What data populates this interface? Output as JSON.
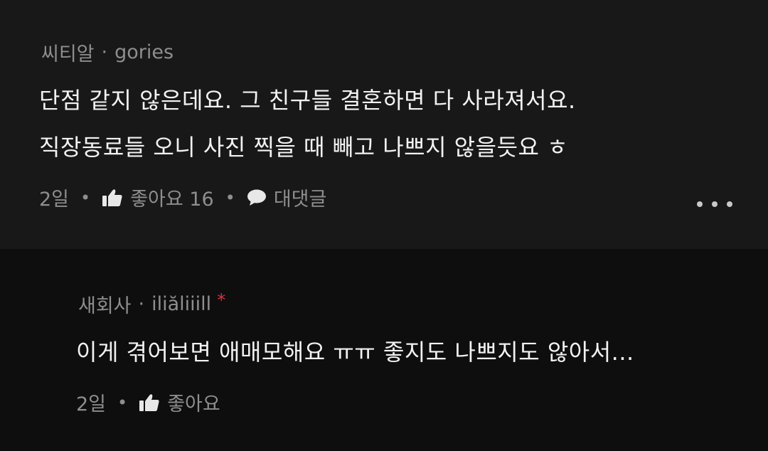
{
  "comments": [
    {
      "company": "씨티알",
      "separator": "·",
      "nickname": "gories",
      "lines": [
        "단점 같지 않은데요. 그 친구들 결혼하면 다 사라져서요.",
        "직장동료들 오니 사진 찍을 때 빼고 나쁘지 않을듯요 ㅎ"
      ],
      "time": "2일",
      "like_label": "좋아요 16",
      "reply_label": "대댓글"
    },
    {
      "company": "새회사",
      "separator": "·",
      "nickname": "iliăliiill",
      "author_marker": "*",
      "lines": [
        "이게 겪어보면 애매모해요 ㅠㅠ 좋지도 나쁘지도 않아서..."
      ],
      "time": "2일",
      "like_label": "좋아요"
    }
  ],
  "colors": {
    "background": "#131313",
    "text_primary": "#f2f2f2",
    "text_secondary": "#8e8e8e",
    "author_marker": "#e0323a"
  },
  "icons": [
    "thumbs-up-icon",
    "speech-bubble-icon",
    "more-dots-icon"
  ]
}
